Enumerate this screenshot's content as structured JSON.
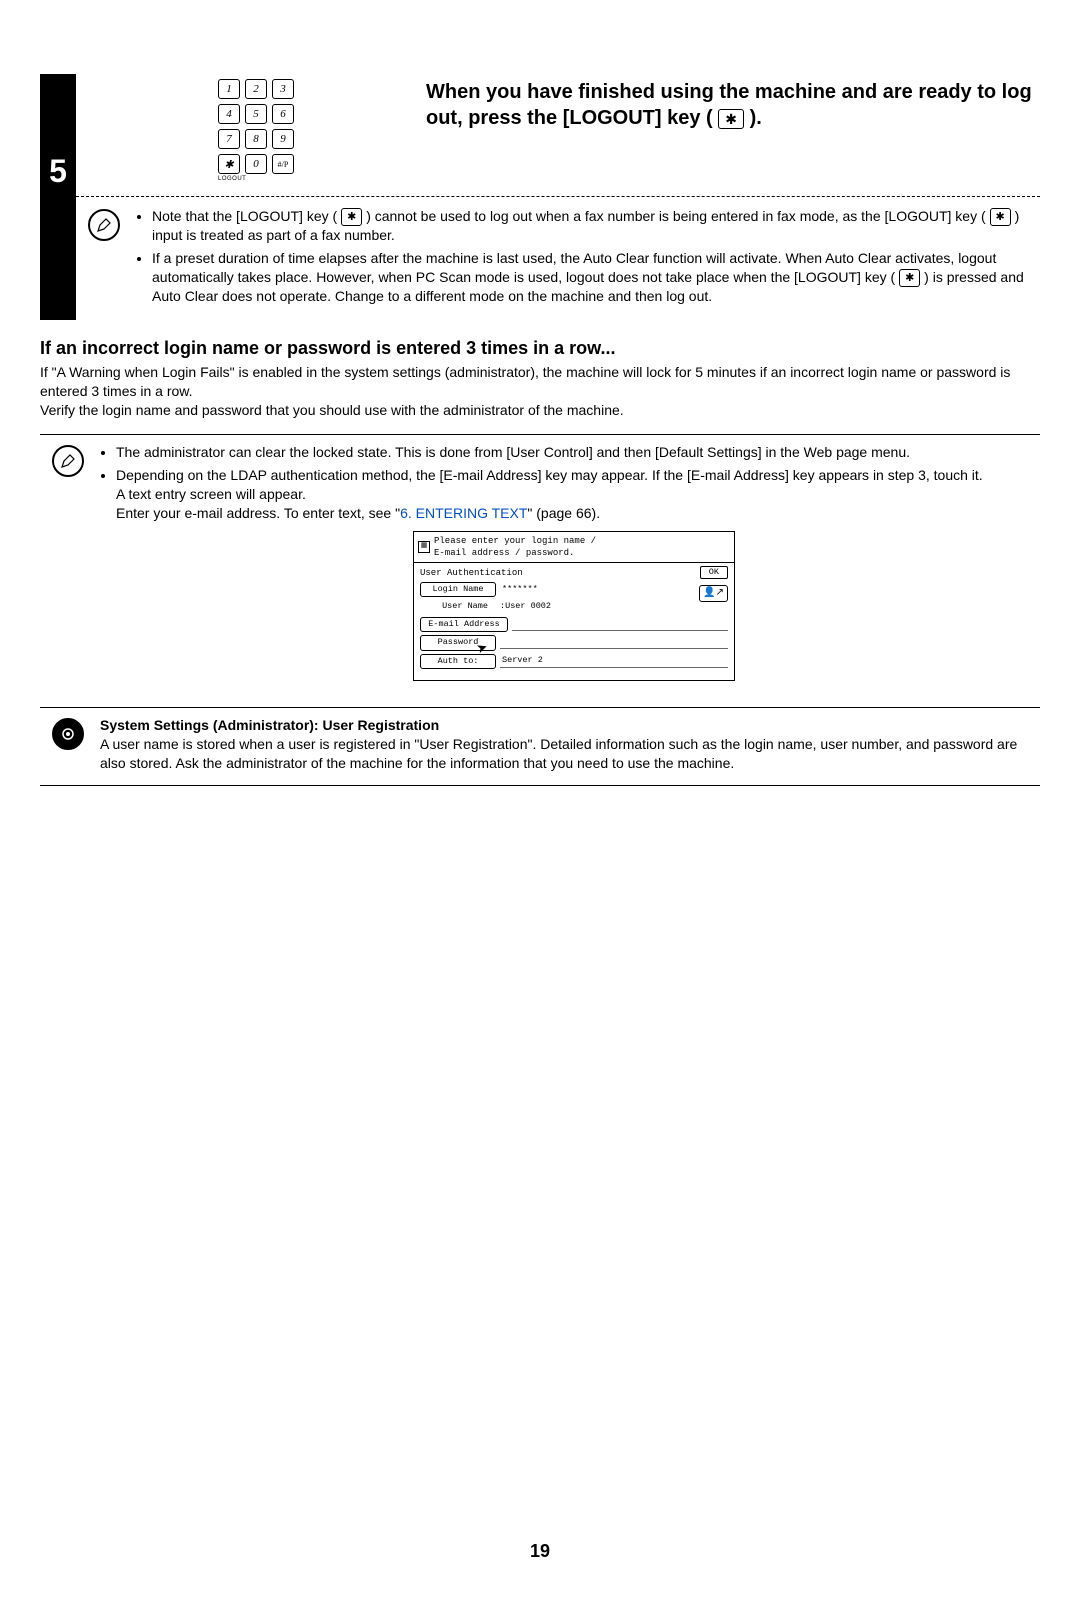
{
  "step": {
    "number": "5",
    "instruction_prefix": "When you have finished using the machine and are ready to log out, press the [LOGOUT] key (",
    "instruction_suffix": ").",
    "keypad": [
      "1",
      "2",
      "3",
      "4",
      "5",
      "6",
      "7",
      "8",
      "9",
      "",
      "0",
      "#/P"
    ],
    "keypad_star": "✱",
    "logout_label": "LOGOUT",
    "note1a": "Note that the [LOGOUT] key (",
    "note1b": ") cannot be used to log out when a fax number is being entered in fax mode, as the [LOGOUT] key (",
    "note1c": ") input is treated as part of a fax number.",
    "note2a": "If a preset duration of time elapses after the machine is last used, the Auto Clear function will activate. When Auto Clear activates, logout automatically takes place. However, when PC Scan mode is used, logout does not take place when the [LOGOUT] key (",
    "note2b": ") is pressed and Auto Clear does not operate. Change to a different mode on the machine and then log out.",
    "star": "✱"
  },
  "section": {
    "heading": "If an incorrect login name or password is entered 3 times in a row...",
    "body1": "If \"A Warning when Login Fails\" is enabled in the system settings (administrator), the machine will lock for 5 minutes if an incorrect login name or password is entered 3 times in a row.",
    "body2": "Verify the login name and password that you should use with the administrator of the machine."
  },
  "admin_note": {
    "bullet1": "The administrator can clear the locked state. This is done from [User Control] and then [Default Settings] in the Web page menu.",
    "bullet2_pre": "Depending on the LDAP authentication method, the [E-mail Address] key may appear. If the [E-mail Address] key appears in step 3, touch it.",
    "bullet2_line2": "A text entry screen will appear.",
    "bullet2_line3a": "Enter your e-mail address. To enter text, see \"",
    "bullet2_link": "6. ENTERING TEXT",
    "bullet2_line3b": "\" (page 66)."
  },
  "screenshot": {
    "header_line1": "Please enter your login name /",
    "header_line2": "E-mail address / password.",
    "title": "User Authentication",
    "ok": "OK",
    "login_name_btn": "Login Name",
    "login_name_val": "*******",
    "user_name_btn": "User Name",
    "user_name_val": ":User 0002",
    "email_btn": "E-mail Address",
    "email_val": "",
    "password_btn": "Password",
    "password_val": "",
    "auth_btn": "Auth to:",
    "auth_val": "Server 2"
  },
  "sys_note": {
    "heading": "System Settings (Administrator): User Registration",
    "body": "A user name is stored when a user is registered in \"User Registration\". Detailed information such as the login name, user number, and password are also stored. Ask the administrator of the machine for the information that you need to use the machine."
  },
  "page_number": "19"
}
